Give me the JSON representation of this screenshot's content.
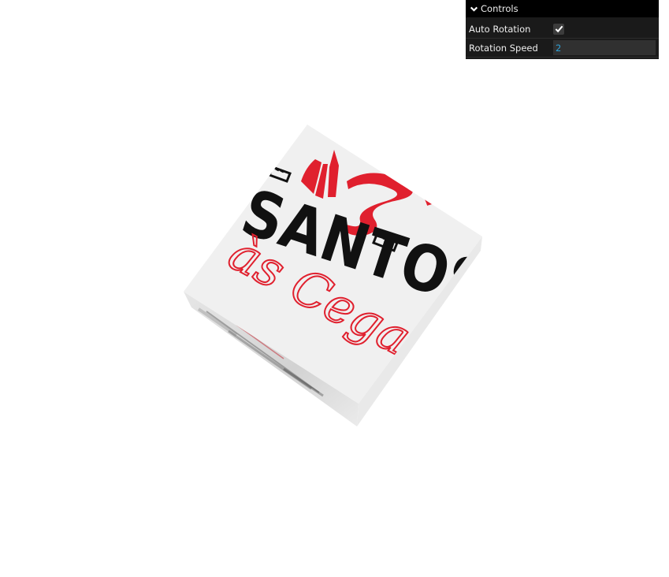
{
  "controls": {
    "title": "Controls",
    "auto_rotation": {
      "label": "Auto Rotation",
      "checked": true
    },
    "rotation_speed": {
      "label": "Rotation Speed",
      "value": "2"
    }
  },
  "cube_face": {
    "line1": "SANTOS",
    "line2": "às Cegas"
  },
  "colors": {
    "panel_bg": "#1a1a1a",
    "panel_title_bg": "#000000",
    "number_text": "#2fa1d6",
    "logo_black": "#111111",
    "logo_red": "#e0202e",
    "cube_face": "#f0f0f0"
  }
}
